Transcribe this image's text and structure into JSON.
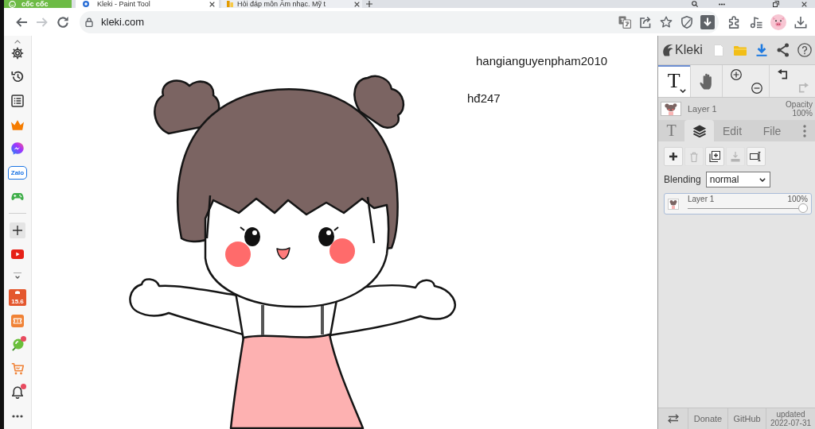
{
  "browser": {
    "brand": "cốc cốc",
    "tabs": [
      {
        "title": "Kleki - Paint Tool",
        "selected": true
      },
      {
        "title": "Hỏi đáp môn Âm nhạc. Mỹ t",
        "selected": false
      }
    ],
    "nav": [
      {
        "kind": "back",
        "disabled": false
      },
      {
        "kind": "forward",
        "disabled": true
      },
      {
        "kind": "reload",
        "disabled": false
      }
    ],
    "url": "kleki.com"
  },
  "sidebar": {
    "groups": [
      {
        "items": [
          {
            "kind": "scroll-up",
            "badge": false
          },
          {
            "kind": "settings",
            "badge": false
          },
          {
            "kind": "history",
            "badge": false
          },
          {
            "kind": "reading-list",
            "badge": false
          },
          {
            "kind": "crown",
            "badge": false
          },
          {
            "kind": "messenger",
            "badge": false
          },
          {
            "kind": "zalo",
            "label": "Zalo",
            "badge": false
          },
          {
            "kind": "games",
            "badge": false
          }
        ]
      },
      {
        "items": [
          {
            "kind": "add",
            "badge": false
          },
          {
            "kind": "youtube",
            "badge": false
          },
          {
            "kind": "collapse",
            "badge": false
          },
          {
            "kind": "calendar",
            "label": "15.6",
            "badge": false
          },
          {
            "kind": "ticket",
            "badge": false
          },
          {
            "kind": "lollipop",
            "badge": true
          },
          {
            "kind": "shop",
            "badge": false
          },
          {
            "kind": "notifications",
            "badge": true
          },
          {
            "kind": "more",
            "badge": false
          }
        ]
      }
    ]
  },
  "canvas": {
    "texts": [
      "hangianguyenpham2010",
      "hđ247"
    ]
  },
  "paint_panel": {
    "title": "Kleki",
    "tools": [
      {
        "kind": "text",
        "label": "T",
        "selected": true
      },
      {
        "kind": "hand",
        "selected": false
      }
    ],
    "history": [
      {
        "kind": "undo",
        "disabled": false
      },
      {
        "kind": "redo",
        "disabled": true
      }
    ],
    "current_layer": {
      "name": "Layer 1",
      "opacity_label": "Opacity",
      "opacity": "100%"
    },
    "tabs": [
      {
        "kind": "tool",
        "label": "T",
        "selected": false
      },
      {
        "kind": "layers",
        "selected": true
      },
      {
        "kind": "label",
        "label": "Edit",
        "selected": false
      },
      {
        "kind": "label",
        "label": "File",
        "selected": false
      },
      {
        "kind": "more",
        "selected": false
      }
    ],
    "layer_actions": [
      {
        "kind": "add",
        "disabled": false
      },
      {
        "kind": "delete",
        "disabled": true
      },
      {
        "kind": "duplicate",
        "disabled": false
      },
      {
        "kind": "merge",
        "disabled": true
      },
      {
        "kind": "rename",
        "disabled": false
      }
    ],
    "blending": {
      "label": "Blending",
      "value": "normal"
    },
    "layers": [
      {
        "name": "Layer 1",
        "opacity": "100%",
        "level": 1,
        "selected": true
      }
    ],
    "footer": [
      {
        "kind": "swap"
      },
      {
        "kind": "link",
        "label": "Donate"
      },
      {
        "kind": "link",
        "label": "GitHub"
      },
      {
        "kind": "info",
        "label": "updated 2022-07-31"
      }
    ]
  }
}
